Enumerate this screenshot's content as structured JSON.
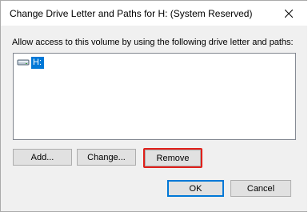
{
  "window": {
    "title": "Change Drive Letter and Paths for H: (System Reserved)",
    "close_icon": "close-icon"
  },
  "description": "Allow access to this volume by using the following drive letter and paths:",
  "list": {
    "items": [
      {
        "label": "H:",
        "icon": "drive-icon",
        "selected": true
      }
    ]
  },
  "buttons": {
    "add": "Add...",
    "change": "Change...",
    "remove": "Remove",
    "ok": "OK",
    "cancel": "Cancel"
  },
  "colors": {
    "selection": "#0078d7",
    "highlight": "#e0201a",
    "default_button_border": "#0078d7"
  }
}
